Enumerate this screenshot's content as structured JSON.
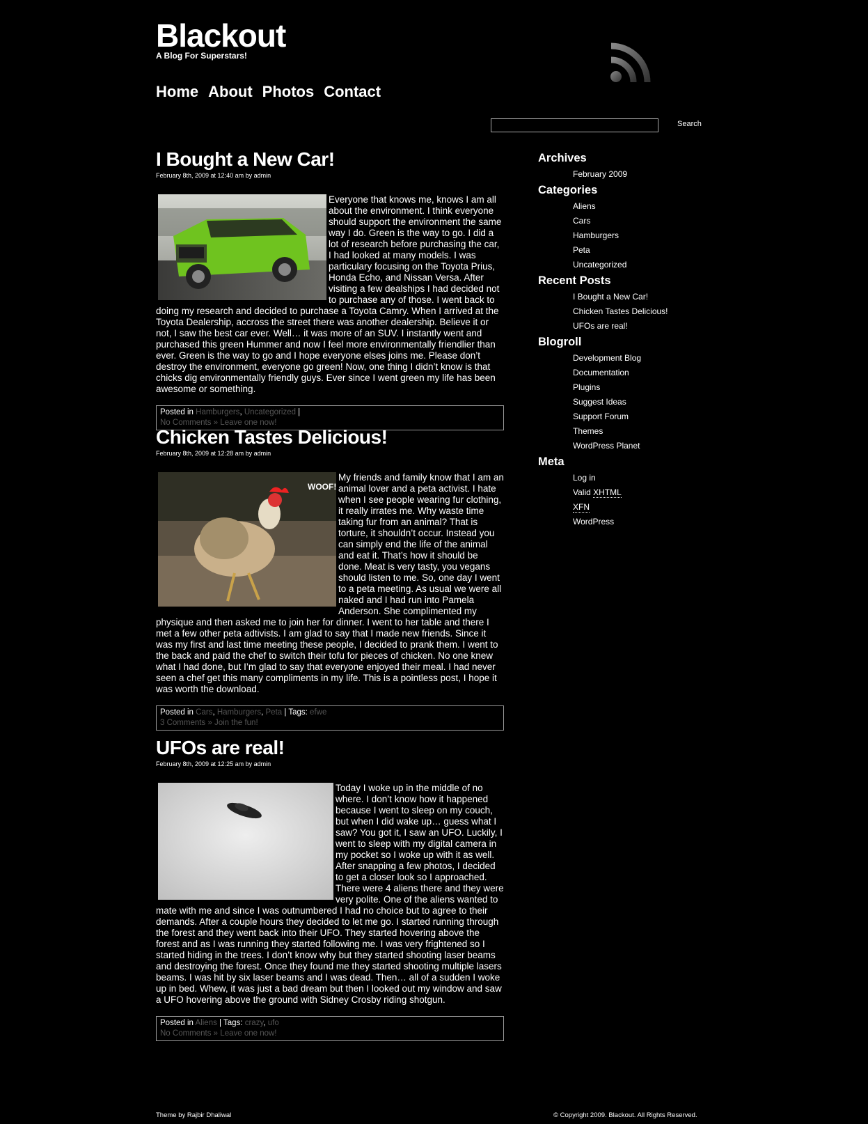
{
  "site": {
    "title": "Blackout",
    "tagline": "A Blog For Superstars!"
  },
  "nav": [
    "Home",
    "About",
    "Photos",
    "Contact"
  ],
  "search": {
    "button": "Search",
    "value": ""
  },
  "posts": [
    {
      "title": "I Bought a New Car!",
      "meta": "February 8th, 2009 at 12:40 am by admin",
      "image": "green-hummer-photo",
      "body": "Everyone that knows me, knows I am all about the environment. I think everyone should support the environment the same way I do. Green is the way to go. I did a lot of research before purchasing the car, I had looked at many models. I was particulary focusing on the Toyota Prius, Honda Echo, and Nissan Versa. After visiting a few dealships I had decided not to purchase any of those. I went back to doing my research and decided to purchase a Toyota Camry. When I arrived at the Toyota Dealership, accross the street there was another dealership. Believe it or not, I saw the best car ever. Well… it was more of an SUV. I instantly went and purchased this green Hummer and now I feel more environmentally friendlier than ever. Green is the way to go and I hope everyone elses joins me. Please don’t destroy the environment, everyone go green! Now, one thing I didn’t know is that chicks dig environmentally friendly guys. Ever since I went green my life has been awesome or something.",
      "posted_in_label": "Posted in",
      "categories": [
        "Hamburgers",
        "Uncategorized"
      ],
      "tags_label": "",
      "tags": [],
      "comments": "No Comments »",
      "comments_action": "Leave one now!"
    },
    {
      "title": "Chicken Tastes Delicious!",
      "meta": "February 8th, 2009 at 12:28 am by admin",
      "image": "rooster-photo",
      "image_text": "WOOF! WOOF!",
      "body": "My friends and family know that I am an animal lover and a peta activist. I hate when I see people wearing fur clothing, it really irrates me. Why waste time taking fur from an animal? That is torture, it shouldn’t occur. Instead you can simply end the life of the animal and eat it. That’s how it should be done. Meat is very tasty, you vegans should listen to me. So, one day I went to a peta meeting. As usual we were all naked and I had run into Pamela Anderson. She complimented my physique and then asked me to join her for dinner. I went to her table and there I met a few other peta adtivists. I am glad to say that I made new friends. Since it was my first and last time meeting these people, I decided to prank them. I went to the back and paid the chef to switch their tofu for pieces of chicken. No one knew what I had done, but I’m glad to say that everyone enjoyed their meal. I had never seen a chef get this many compliments in my life. This is a pointless post, I hope it was worth the download.",
      "posted_in_label": "Posted in",
      "categories": [
        "Cars",
        "Hamburgers",
        "Peta"
      ],
      "tags_label": "Tags:",
      "tags": [
        "efwe"
      ],
      "comments": "3 Comments »",
      "comments_action": "Join the fun!"
    },
    {
      "title": "UFOs are real!",
      "meta": "February 8th, 2009 at 12:25 am by admin",
      "image": "ufo-photo",
      "body": "Today I woke up in the middle of no where. I don’t know how it happened because I went to sleep on my couch, but when I did wake up… guess what I saw? You got it, I saw an UFO. Luckily, I went to sleep with my digital camera in my pocket so I woke up with it as well. After snapping a few photos, I decided to get a closer look so I approached. There were 4 aliens there and they were very polite. One of the aliens wanted to mate with me and since I was outnumbered I had no choice but to agree to their demands. After a couple hours they decided to let me go. I started running through the forest and they went back into their UFO. They started hovering above the forest and as I was running they started following me. I was very frightened so I started hiding in the trees. I don’t know why but they started shooting laser beams and destroying the forest. Once they found me they started shooting multiple lasers beams. I was hit by six laser beams and I was dead. Then… all of a sudden I woke up in bed. Whew, it was just a bad dream but then I looked out my window and saw a UFO hovering above the ground with Sidney Crosby riding shotgun.",
      "posted_in_label": "Posted in",
      "categories": [
        "Aliens"
      ],
      "tags_label": "Tags:",
      "tags": [
        "crazy",
        "ufo"
      ],
      "comments": "No Comments »",
      "comments_action": "Leave one now!"
    }
  ],
  "sidebar": {
    "archives": {
      "title": "Archives",
      "items": [
        "February 2009"
      ]
    },
    "categories": {
      "title": "Categories",
      "items": [
        "Aliens",
        "Cars",
        "Hamburgers",
        "Peta",
        "Uncategorized"
      ]
    },
    "recent": {
      "title": "Recent Posts",
      "items": [
        "I Bought a New Car!",
        "Chicken Tastes Delicious!",
        "UFOs are real!"
      ]
    },
    "blogroll": {
      "title": "Blogroll",
      "items": [
        "Development Blog",
        "Documentation",
        "Plugins",
        "Suggest Ideas",
        "Support Forum",
        "Themes",
        "WordPress Planet"
      ]
    },
    "meta": {
      "title": "Meta",
      "login": "Log in",
      "valid_prefix": "Valid",
      "valid_xhtml": "XHTML",
      "xfn": "XFN",
      "wordpress": "WordPress"
    }
  },
  "footer": {
    "left": "Theme by Rajbir Dhaliwal",
    "right": "© Copyright 2009. Blackout. All Rights Reserved."
  }
}
